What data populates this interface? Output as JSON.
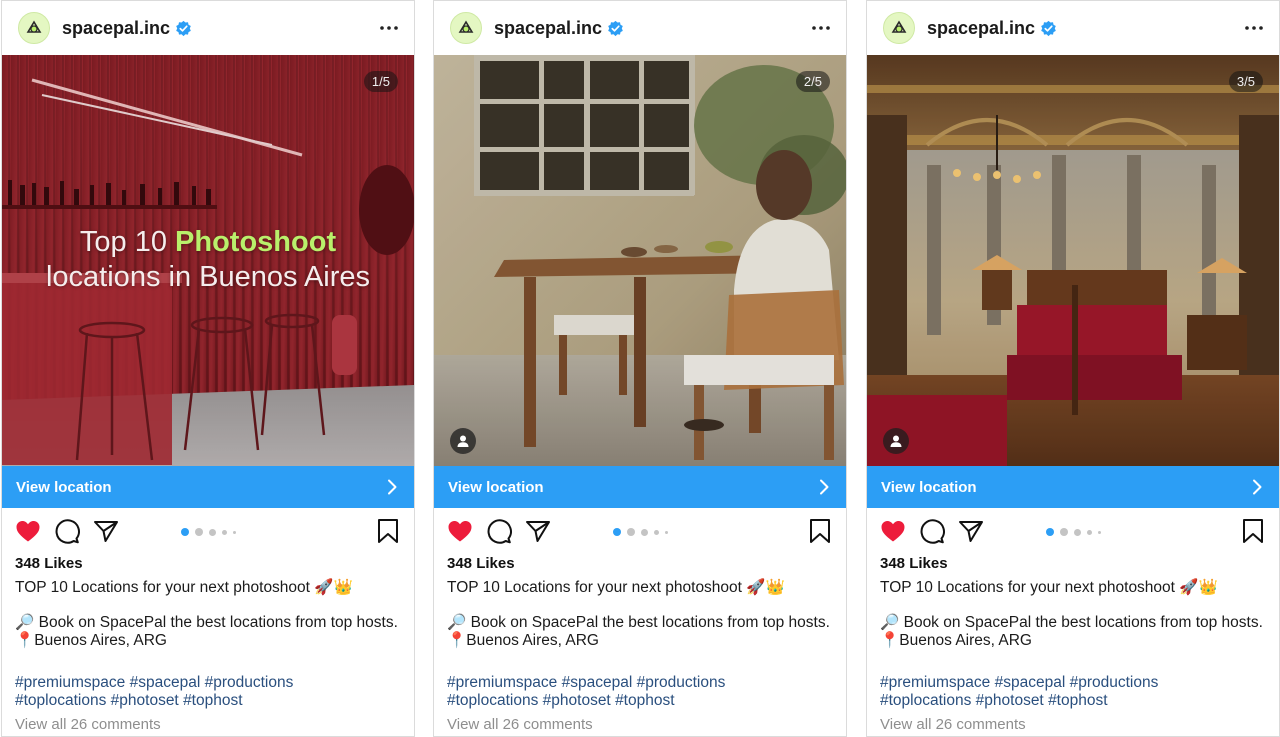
{
  "colors": {
    "accent": "#2c9ef5",
    "like": "#ed1c3b",
    "hashtag": "#2a4f7e",
    "muted": "#8e8e8e",
    "highlight": "#b9f06b"
  },
  "posts": [
    {
      "username": "spacepal.inc",
      "verified_icon": "verified-badge-icon",
      "counter": "1/5",
      "overlay": {
        "line1_pre": "Top 10 ",
        "line1_highlight": "Photoshoot",
        "line2": "locations in Buenos Aires"
      },
      "cta_label": "View location",
      "liked": true,
      "carousel_index": 1,
      "likes": "348 Likes",
      "caption": "TOP 10 Locations for your next photoshoot 🚀👑",
      "desc_line1": "🔎 Book on SpacePal the best locations from top hosts.",
      "desc_line2": "📍Buenos Aires, ARG",
      "tags": [
        "#premiumspace",
        "#spacepal",
        "#productions",
        "#toplocations",
        "#photoset",
        "#tophost"
      ],
      "comments": "View all 26 comments"
    },
    {
      "username": "spacepal.inc",
      "verified_icon": "verified-badge-icon",
      "counter": "2/5",
      "cta_label": "View location",
      "liked": true,
      "carousel_index": 1,
      "likes": "348 Likes",
      "caption": "TOP 10 Locations for your next photoshoot 🚀👑",
      "desc_line1": "🔎 Book on SpacePal the best locations from top hosts.",
      "desc_line2": "📍Buenos Aires, ARG",
      "tags": [
        "#premiumspace",
        "#spacepal",
        "#productions",
        "#toplocations",
        "#photoset",
        "#tophost"
      ],
      "comments": "View all 26 comments"
    },
    {
      "username": "spacepal.inc",
      "verified_icon": "verified-badge-icon",
      "counter": "3/5",
      "cta_label": "View location",
      "liked": true,
      "carousel_index": 1,
      "likes": "348 Likes",
      "caption": "TOP 10 Locations for your next photoshoot 🚀👑",
      "desc_line1": "🔎 Book on SpacePal the best locations from top hosts.",
      "desc_line2": "📍Buenos Aires, ARG",
      "tags": [
        "#premiumspace",
        "#spacepal",
        "#productions",
        "#toplocations",
        "#photoset",
        "#tophost"
      ],
      "comments": "View all 26 comments"
    }
  ]
}
